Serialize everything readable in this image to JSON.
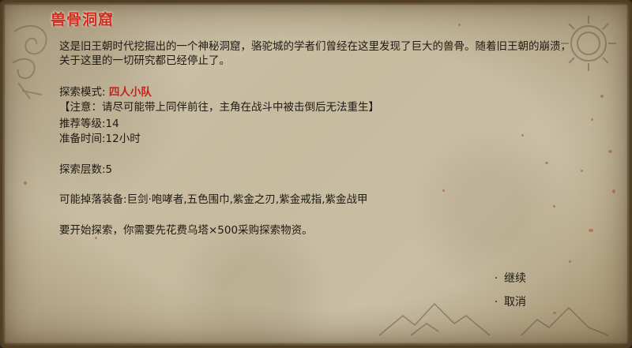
{
  "dialog": {
    "title": "兽骨洞窟",
    "description": "这是旧王朝时代挖掘出的一个神秘洞窟，骆驼城的学者们曾经在这里发现了巨大的兽骨。随着旧王朝的崩溃，关于这里的一切研究都已经停止了。",
    "mode_label": "探索模式: ",
    "mode_value": "四人小队",
    "note": "【注意：请尽可能带上同伴前往，主角在战斗中被击倒后无法重生】",
    "recommended_level": "推荐等级:14",
    "prep_time": "准备时间:12小时",
    "floors": "探索层数:5",
    "drops": "可能掉落装备:巨剑·咆哮者,五色围巾,紫金之刃,紫金戒指,紫金战甲",
    "cost": "要开始探索，你需要先花费乌塔×500采购探索物资。"
  },
  "menu": {
    "continue_label": "继续",
    "cancel_label": "取消",
    "bullet": "·"
  },
  "colors": {
    "title_red": "#d22a1c",
    "mode_red": "#c8201a",
    "parchment": "#c9bfa5",
    "ink": "#1f1a14"
  }
}
